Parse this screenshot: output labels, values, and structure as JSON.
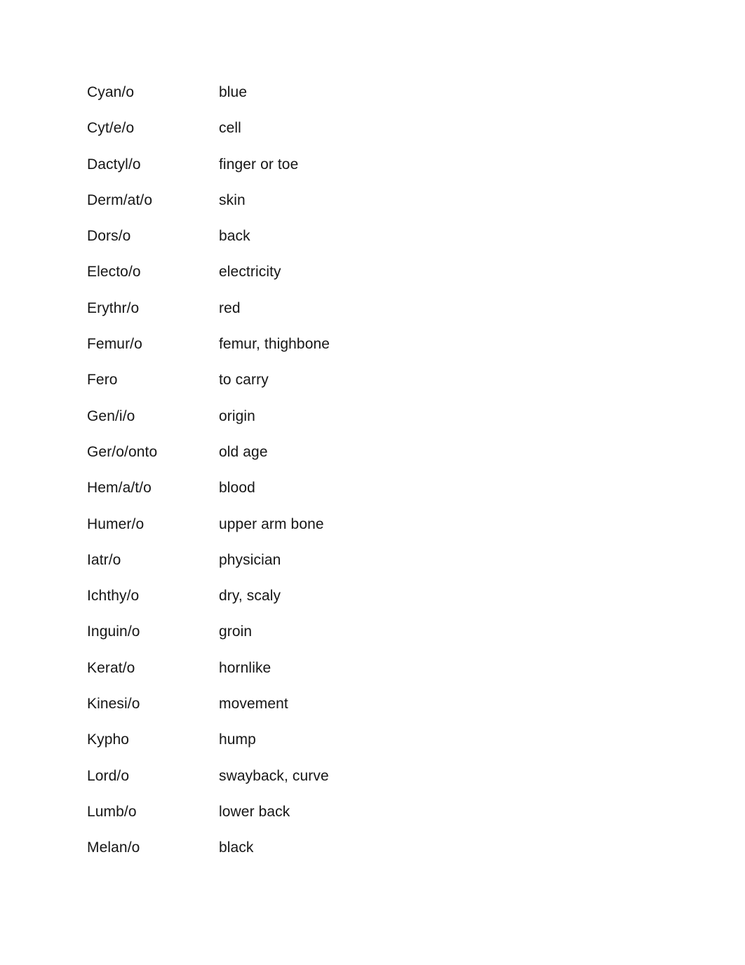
{
  "document": {
    "type": "word-list",
    "page_background": "#ffffff",
    "text_color": "#161616",
    "columns": {
      "term_header": "",
      "definition_header": ""
    },
    "entries": [
      {
        "term": "Cyan/o",
        "definition": "blue"
      },
      {
        "term": "Cyt/e/o",
        "definition": "cell"
      },
      {
        "term": "Dactyl/o",
        "definition": "finger or toe"
      },
      {
        "term": "Derm/at/o",
        "definition": "skin"
      },
      {
        "term": "Dors/o",
        "definition": "back"
      },
      {
        "term": "Electo/o",
        "definition": "electricity"
      },
      {
        "term": "Erythr/o",
        "definition": "red"
      },
      {
        "term": "Femur/o",
        "definition": "femur, thighbone"
      },
      {
        "term": "Fero",
        "definition": "to carry"
      },
      {
        "term": "Gen/i/o",
        "definition": "origin"
      },
      {
        "term": "Ger/o/onto",
        "definition": "old age"
      },
      {
        "term": "Hem/a/t/o",
        "definition": "blood"
      },
      {
        "term": "Humer/o",
        "definition": "upper arm bone"
      },
      {
        "term": "Iatr/o",
        "definition": "physician"
      },
      {
        "term": "Ichthy/o",
        "definition": "dry, scaly"
      },
      {
        "term": "Inguin/o",
        "definition": "groin"
      },
      {
        "term": "Kerat/o",
        "definition": "hornlike"
      },
      {
        "term": "Kinesi/o",
        "definition": "movement"
      },
      {
        "term": "Kypho",
        "definition": "hump"
      },
      {
        "term": "Lord/o",
        "definition": "swayback, curve"
      },
      {
        "term": "Lumb/o",
        "definition": "lower back"
      },
      {
        "term": "Melan/o",
        "definition": "black"
      }
    ]
  }
}
